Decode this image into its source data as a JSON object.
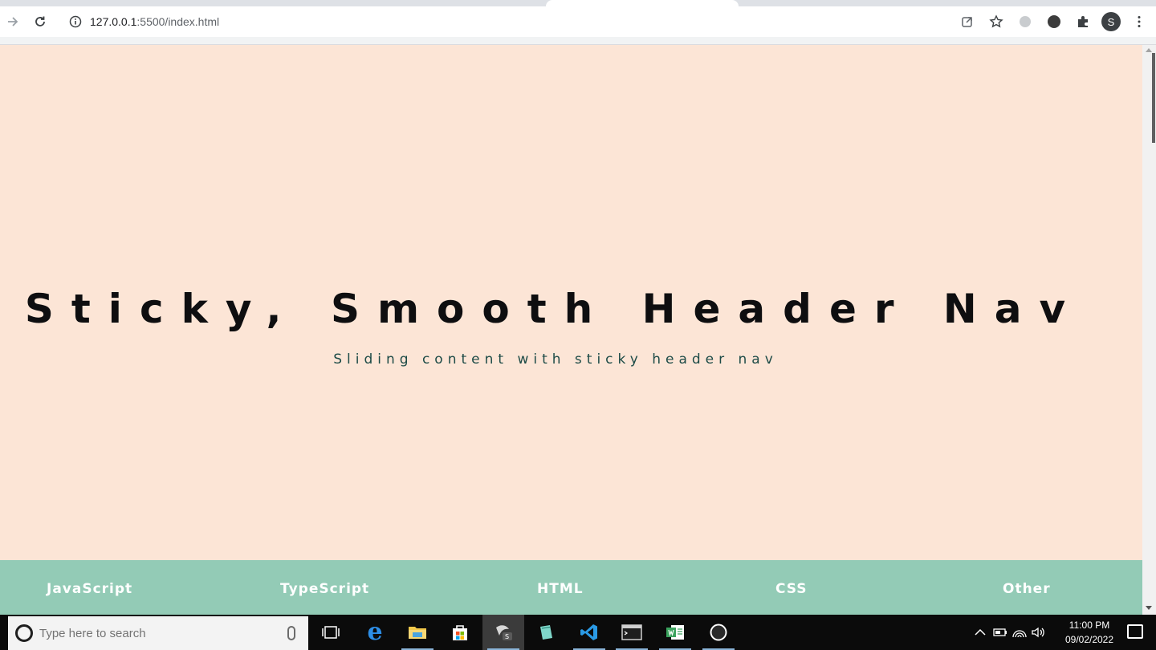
{
  "browser": {
    "url_host": "127.0.0.1",
    "url_rest": ":5500/index.html",
    "profile_initial": "S"
  },
  "page": {
    "title": "Sticky, Smooth Header Nav",
    "subtitle": "Sliding content with sticky header nav",
    "background_color": "#fce5d6",
    "nav_color": "#93cbb6",
    "nav_items": [
      "JavaScript",
      "TypeScript",
      "HTML",
      "CSS",
      "Other"
    ]
  },
  "taskbar": {
    "search_placeholder": "Type here to search",
    "time": "11:00 PM",
    "date": "09/02/2022",
    "apps": [
      "task-view-icon",
      "edge-icon",
      "file-explorer-icon",
      "store-icon",
      "sublime-icon",
      "notes-icon",
      "vscode-icon",
      "terminal-icon",
      "word-icon",
      "obs-icon"
    ]
  }
}
